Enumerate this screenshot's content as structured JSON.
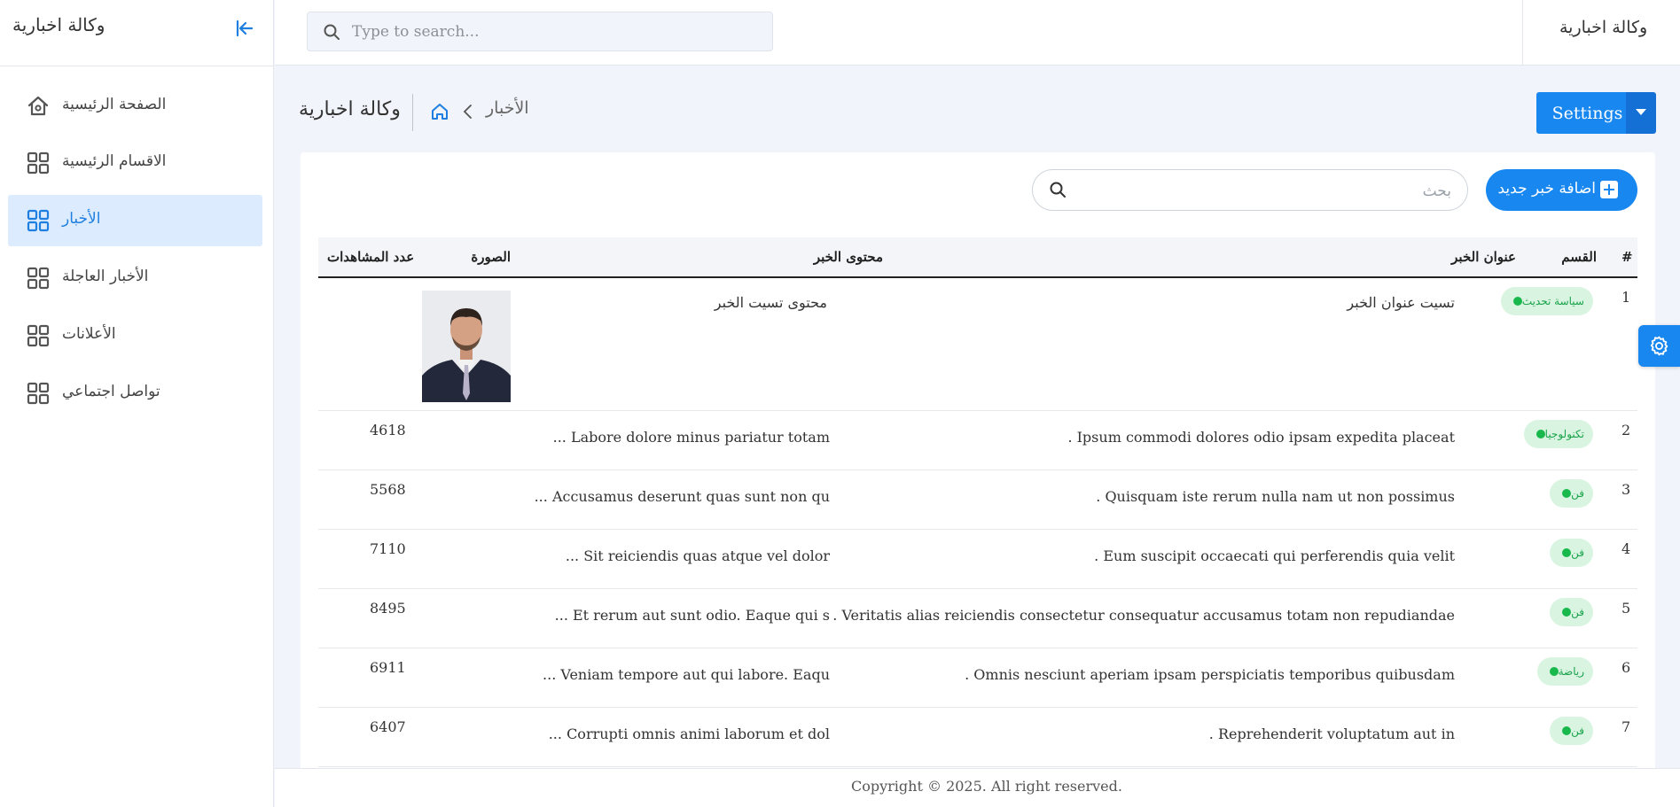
{
  "sidebar": {
    "brand": "وكالة اخبارية",
    "items": [
      {
        "label": "الصفحة الرئيسية",
        "icon": "home-icon",
        "active": false
      },
      {
        "label": "الاقسام الرئيسية",
        "icon": "grid-icon",
        "active": false
      },
      {
        "label": "الأخبار",
        "icon": "grid-icon",
        "active": true
      },
      {
        "label": "الأخبار العاجلة",
        "icon": "grid-icon",
        "active": false
      },
      {
        "label": "الأعلانات",
        "icon": "grid-icon",
        "active": false
      },
      {
        "label": "تواصل اجتماعي",
        "icon": "grid-icon",
        "active": false
      }
    ]
  },
  "topbar": {
    "search_placeholder": "Type to search...",
    "brand": "وكالة اخبارية"
  },
  "page_header": {
    "title": "وكالة اخبارية",
    "breadcrumb_current": "الأخبار",
    "settings_label": "Settings"
  },
  "toolbar": {
    "add_label": "اضافة خبر جديد",
    "search_placeholder": "بحث"
  },
  "table": {
    "headers": {
      "index": "#",
      "category": "القسم",
      "title": "عنوان الخبر",
      "content": "محتوى الخبر",
      "image": "الصورة",
      "views": "عدد المشاهدات"
    },
    "rows": [
      {
        "index": "1",
        "category": "سياسة تحديث",
        "title": "تسيت عنوان الخبر",
        "content": "محتوى تسيت الخبر",
        "has_image": true,
        "views": ""
      },
      {
        "index": "2",
        "category": "تكنولوجيا",
        "title": ". Ipsum commodi dolores odio ipsam expedita placeat",
        "content": "... Labore dolore minus pariatur totam",
        "has_image": false,
        "views": "4618"
      },
      {
        "index": "3",
        "category": "فن",
        "title": ". Quisquam iste rerum nulla nam ut non possimus",
        "content": "... Accusamus deserunt quas sunt non qu",
        "has_image": false,
        "views": "5568"
      },
      {
        "index": "4",
        "category": "فن",
        "title": ". Eum suscipit occaecati qui perferendis quia velit",
        "content": "... Sit reiciendis quas atque vel dolor",
        "has_image": false,
        "views": "7110"
      },
      {
        "index": "5",
        "category": "فن",
        "title": ". Veritatis alias reiciendis consectetur consequatur accusamus totam non repudiandae",
        "content": "... Et rerum aut sunt odio. Eaque qui s",
        "has_image": false,
        "views": "8495"
      },
      {
        "index": "6",
        "category": "رياضة",
        "title": ". Omnis nesciunt aperiam ipsam perspiciatis temporibus quibusdam",
        "content": "... Veniam tempore aut qui labore. Eaqu",
        "has_image": false,
        "views": "6911"
      },
      {
        "index": "7",
        "category": "فن",
        "title": ". Reprehenderit voluptatum aut in",
        "content": "... Corrupti omnis animi laborum et dol",
        "has_image": false,
        "views": "6407"
      }
    ]
  },
  "footer": {
    "copyright": "Copyright © 2025. All right reserved."
  },
  "colors": {
    "primary": "#1887f0",
    "active_nav_bg": "#dcebfd",
    "badge_bg": "#d9f5e2",
    "badge_text": "#1aa34a"
  }
}
